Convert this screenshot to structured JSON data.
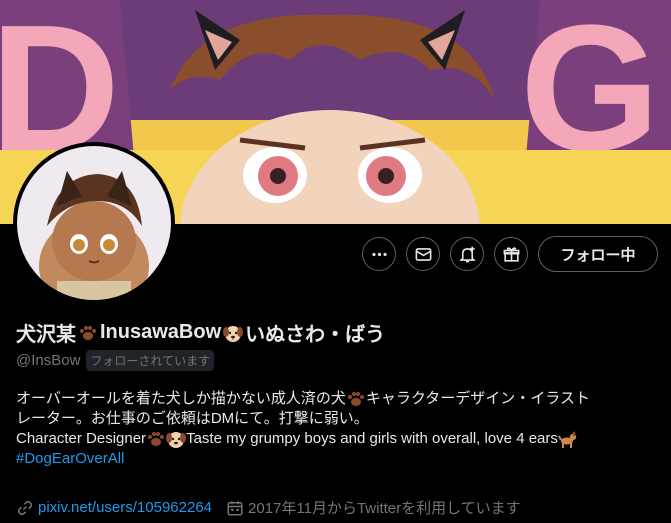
{
  "profile": {
    "name_part1": "犬沢某",
    "name_part2": "InusawaBow",
    "name_part3": "いぬさわ・ばう",
    "handle": "@InsBow",
    "follows_you": "フォローされています",
    "follow_button": "フォロー中"
  },
  "bio": {
    "line1a": "オーバーオールを着た犬しか描かない成人済の犬",
    "line1b": "キャラクターデザイン・イラスト",
    "line2": "レーター。お仕事のご依頼はDMにて。打撃に弱い。",
    "line3a": "Character Designer",
    "line3b": "Taste my grumpy boys and girls with overall, love 4 ears",
    "hashtag": "#DogEarOverAll"
  },
  "meta": {
    "link": "pixiv.net/users/105962264",
    "joined": "2017年11月からTwitterを利用しています"
  },
  "icons": {
    "more": "more-icon",
    "message": "envelope-icon",
    "notify": "bell-plus-icon",
    "subscribe": "gift-icon",
    "link": "link-icon",
    "calendar": "calendar-icon"
  },
  "colors": {
    "background": "#000000",
    "accent": "#1d9bf0",
    "secondary_text": "#71767b",
    "border": "#536471"
  }
}
